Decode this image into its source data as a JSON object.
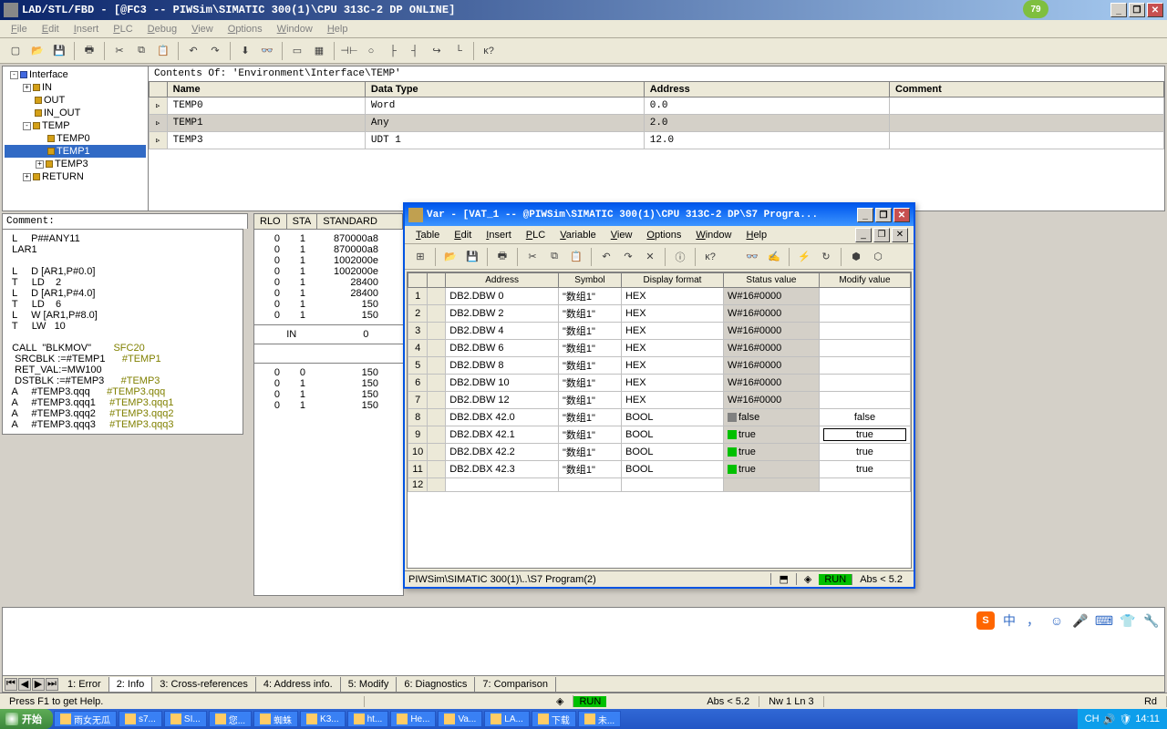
{
  "badge": "79",
  "window": {
    "title": "LAD/STL/FBD  - [@FC3 -- PIWSim\\SIMATIC 300(1)\\CPU 313C-2 DP  ONLINE]",
    "menus": [
      "File",
      "Edit",
      "Insert",
      "PLC",
      "Debug",
      "View",
      "Options",
      "Window",
      "Help"
    ]
  },
  "contents_title": "Contents Of: 'Environment\\Interface\\TEMP'",
  "tree": [
    {
      "indent": 0,
      "pm": "-",
      "icon": "blue",
      "label": "Interface"
    },
    {
      "indent": 1,
      "pm": "+",
      "icon": "gold",
      "label": "IN"
    },
    {
      "indent": 1,
      "pm": "",
      "icon": "gold",
      "label": "OUT"
    },
    {
      "indent": 1,
      "pm": "",
      "icon": "gold",
      "label": "IN_OUT"
    },
    {
      "indent": 1,
      "pm": "-",
      "icon": "gold",
      "label": "TEMP"
    },
    {
      "indent": 2,
      "pm": "",
      "icon": "gold",
      "label": "TEMP0"
    },
    {
      "indent": 2,
      "pm": "",
      "icon": "gold",
      "label": "TEMP1",
      "sel": true
    },
    {
      "indent": 2,
      "pm": "+",
      "icon": "gold",
      "label": "TEMP3"
    },
    {
      "indent": 1,
      "pm": "+",
      "icon": "gold",
      "label": "RETURN"
    }
  ],
  "iface_cols": [
    "Name",
    "Data Type",
    "Address",
    "Comment"
  ],
  "iface_rows": [
    {
      "name": "TEMP0",
      "type": "Word",
      "addr": "0.0",
      "sel": false
    },
    {
      "name": "TEMP1",
      "type": "Any",
      "addr": "2.0",
      "sel": true
    },
    {
      "name": "TEMP3",
      "type": "UDT 1",
      "addr": "12.0",
      "sel": false
    }
  ],
  "comment_label": "Comment:",
  "code": [
    "  L     P##ANY11",
    "  LAR1",
    "",
    "  L     D [AR1,P#0.0]",
    "  T     LD    2",
    "  L     D [AR1,P#4.0]",
    "  T     LD    6",
    "  L     W [AR1,P#8.0]",
    "  T     LW   10",
    "",
    "  CALL  \"BLKMOV\"",
    "   SRCBLK :=#TEMP1",
    "   RET_VAL:=MW100",
    "   DSTBLK :=#TEMP3",
    "  A     #TEMP3.qqq",
    "  A     #TEMP3.qqq1",
    "  A     #TEMP3.qqq2",
    "  A     #TEMP3.qqq3"
  ],
  "code_comments": {
    "10": "SFC20",
    "11": "#TEMP1",
    "13": "#TEMP3",
    "14": "#TEMP3.qqq",
    "15": "#TEMP3.qqq1",
    "16": "#TEMP3.qqq2",
    "17": "#TEMP3.qqq3"
  },
  "status_hdr": [
    "RLO",
    "STA",
    "STANDARD"
  ],
  "status_rows1": [
    [
      "0",
      "1",
      "870000a8"
    ],
    [
      "0",
      "1",
      "870000a8"
    ],
    [
      "",
      "",
      ""
    ],
    [
      "0",
      "1",
      "1002000e"
    ],
    [
      "0",
      "1",
      "1002000e"
    ],
    [
      "0",
      "1",
      "28400"
    ],
    [
      "0",
      "1",
      "28400"
    ],
    [
      "0",
      "1",
      "150"
    ],
    [
      "0",
      "1",
      "150"
    ]
  ],
  "status_in": [
    "IN",
    "0"
  ],
  "status_rows2": [
    [
      "0",
      "0",
      "150"
    ],
    [
      "0",
      "1",
      "150"
    ],
    [
      "0",
      "1",
      "150"
    ],
    [
      "0",
      "1",
      "150"
    ]
  ],
  "var": {
    "title": "Var - [VAT_1 -- @PIWSim\\SIMATIC 300(1)\\CPU 313C-2 DP\\S7 Progra...",
    "menus": [
      "Table",
      "Edit",
      "Insert",
      "PLC",
      "Variable",
      "View",
      "Options",
      "Window",
      "Help"
    ],
    "cols": [
      "",
      "",
      "Address",
      "Symbol",
      "Display format",
      "Status value",
      "Modify value"
    ],
    "rows": [
      {
        "n": "1",
        "addr": "DB2.DBW   0",
        "sym": "\"数组1\"",
        "fmt": "HEX",
        "sv": "W#16#0000",
        "mv": ""
      },
      {
        "n": "2",
        "addr": "DB2.DBW   2",
        "sym": "\"数组1\"",
        "fmt": "HEX",
        "sv": "W#16#0000",
        "mv": ""
      },
      {
        "n": "3",
        "addr": "DB2.DBW   4",
        "sym": "\"数组1\"",
        "fmt": "HEX",
        "sv": "W#16#0000",
        "mv": ""
      },
      {
        "n": "4",
        "addr": "DB2.DBW   6",
        "sym": "\"数组1\"",
        "fmt": "HEX",
        "sv": "W#16#0000",
        "mv": ""
      },
      {
        "n": "5",
        "addr": "DB2.DBW   8",
        "sym": "\"数组1\"",
        "fmt": "HEX",
        "sv": "W#16#0000",
        "mv": ""
      },
      {
        "n": "6",
        "addr": "DB2.DBW  10",
        "sym": "\"数组1\"",
        "fmt": "HEX",
        "sv": "W#16#0000",
        "mv": ""
      },
      {
        "n": "7",
        "addr": "DB2.DBW  12",
        "sym": "\"数组1\"",
        "fmt": "HEX",
        "sv": "W#16#0000",
        "mv": ""
      },
      {
        "n": "8",
        "addr": "DB2.DBX  42.0",
        "sym": "\"数组1\"",
        "fmt": "BOOL",
        "sv": "false",
        "led": "gray",
        "mv": "false"
      },
      {
        "n": "9",
        "addr": "DB2.DBX  42.1",
        "sym": "\"数组1\"",
        "fmt": "BOOL",
        "sv": "true",
        "led": "green",
        "mv": "true",
        "mvsel": true
      },
      {
        "n": "10",
        "addr": "DB2.DBX  42.2",
        "sym": "\"数组1\"",
        "fmt": "BOOL",
        "sv": "true",
        "led": "green",
        "mv": "true"
      },
      {
        "n": "11",
        "addr": "DB2.DBX  42.3",
        "sym": "\"数组1\"",
        "fmt": "BOOL",
        "sv": "true",
        "led": "green",
        "mv": "true"
      },
      {
        "n": "12",
        "addr": "",
        "sym": "",
        "fmt": "",
        "sv": "",
        "mv": ""
      }
    ],
    "status": {
      "path": "PIWSim\\SIMATIC 300(1)\\..\\S7 Program(2)",
      "run": "RUN",
      "abs": "Abs < 5.2"
    }
  },
  "bottom_tabs": [
    "1: Error",
    "2: Info",
    "3: Cross-references",
    "4: Address info.",
    "5: Modify",
    "6: Diagnostics",
    "7: Comparison"
  ],
  "active_tab": 1,
  "tabs_side_label": "中",
  "statusbar": {
    "help": "Press F1 to get Help.",
    "run": "RUN",
    "abs": "Abs < 5.2",
    "pos": "Nw 1  Ln 3",
    "mode": "Rd"
  },
  "taskbar": {
    "start": "开始",
    "items": [
      "雨女无瓜",
      "s7...",
      "SI...",
      "您...",
      "蜘蛛",
      "K3...",
      "ht...",
      "He...",
      "Va...",
      "LA...",
      "下载",
      "未..."
    ],
    "tray": {
      "ime": "CH",
      "time": "14:11"
    }
  }
}
